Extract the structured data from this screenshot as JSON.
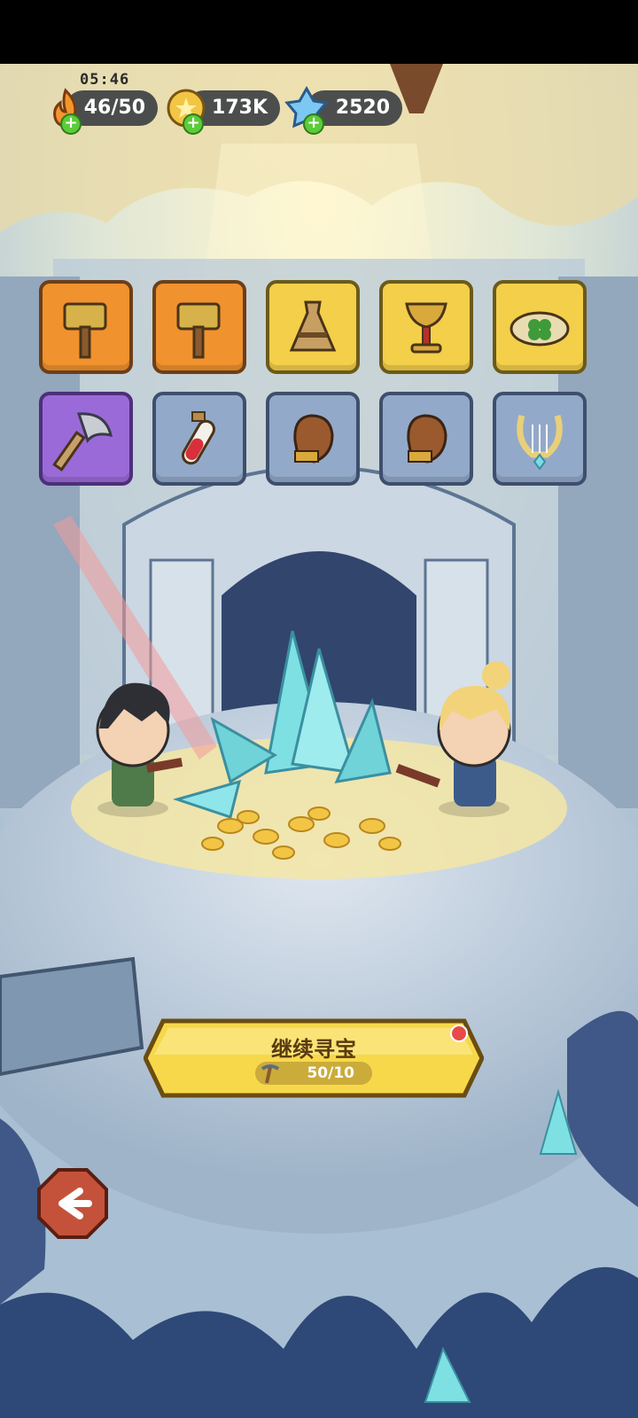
{
  "hud": {
    "timer": "05:46",
    "energy": "46/50",
    "coins": "173K",
    "gems": "2520"
  },
  "items": [
    {
      "row": 1,
      "name": "hammer",
      "rarity": "orange"
    },
    {
      "row": 1,
      "name": "hammer",
      "rarity": "orange"
    },
    {
      "row": 1,
      "name": "vase",
      "rarity": "yellow"
    },
    {
      "row": 1,
      "name": "chalice",
      "rarity": "yellow"
    },
    {
      "row": 1,
      "name": "clover-crown",
      "rarity": "yellow"
    },
    {
      "row": 2,
      "name": "axe",
      "rarity": "purple"
    },
    {
      "row": 2,
      "name": "potion",
      "rarity": "blue"
    },
    {
      "row": 2,
      "name": "glove",
      "rarity": "blue"
    },
    {
      "row": 2,
      "name": "glove",
      "rarity": "blue"
    },
    {
      "row": 2,
      "name": "lyre",
      "rarity": "blue"
    }
  ],
  "action": {
    "title": "继续寻宝",
    "cost": "50/10"
  },
  "colors": {
    "orange_slot": "#f0922e",
    "yellow_slot": "#f3cf4a",
    "purple_slot": "#9a6bd8",
    "blue_slot": "#93a9c9",
    "button": "#f7d84a"
  }
}
